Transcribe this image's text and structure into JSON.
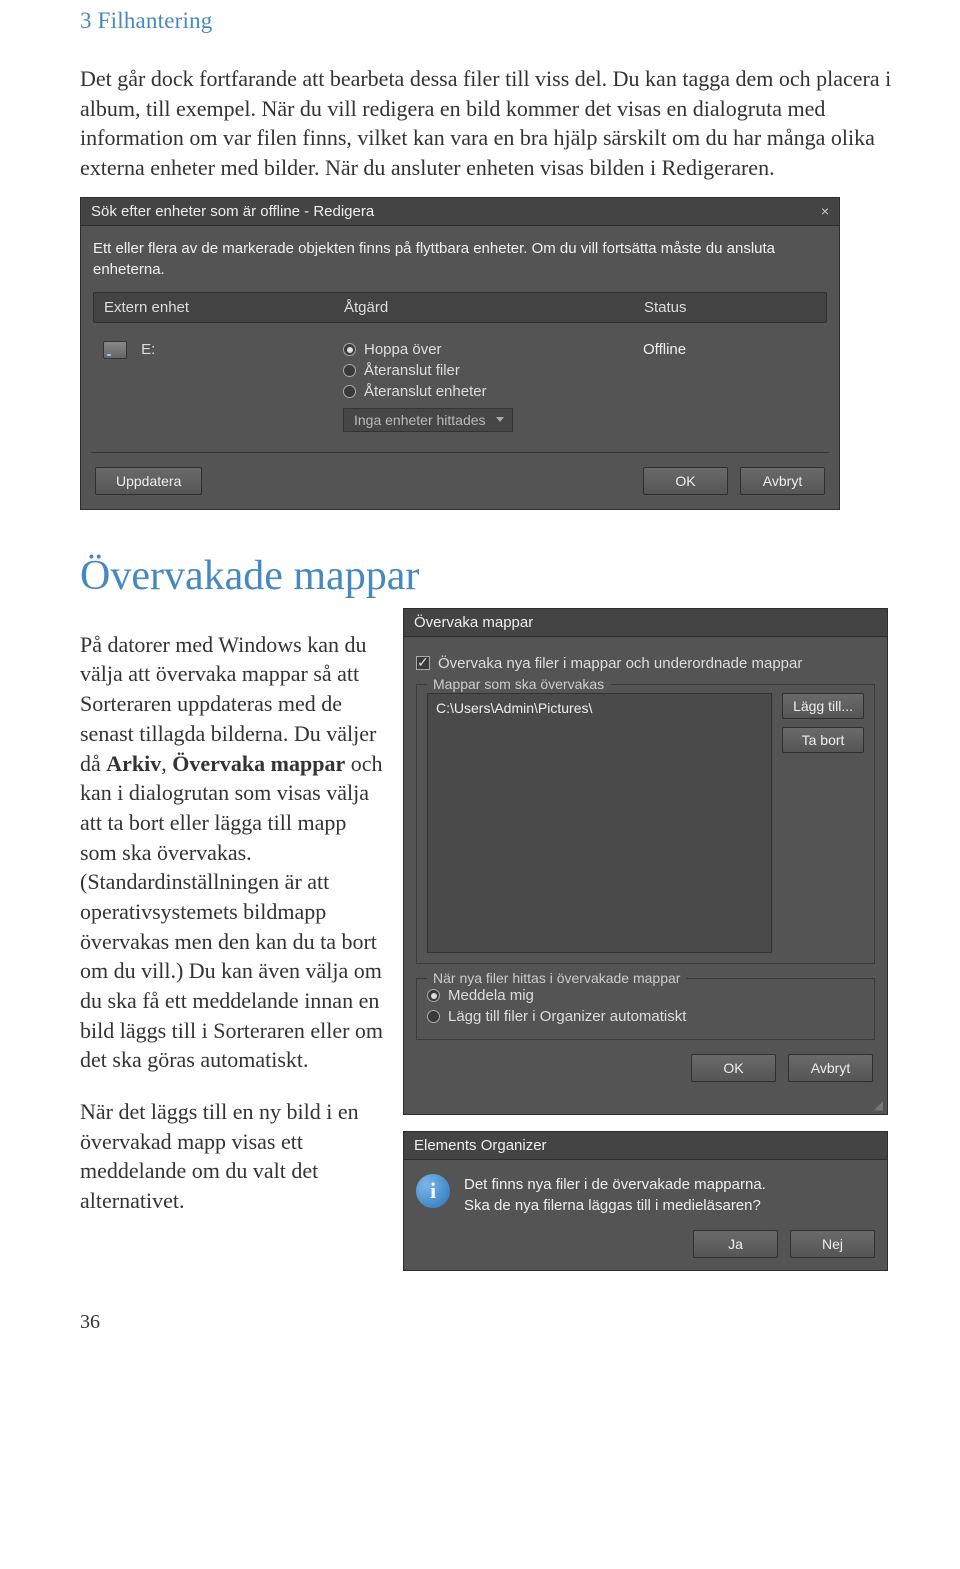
{
  "chapter": "3 Filhantering",
  "para1": "Det går dock fortfarande att bearbeta dessa filer till viss del. Du kan tagga dem och placera i album, till exempel. När du vill redigera en bild kommer det visas en dialogruta med information om var filen finns, vilket kan vara en bra hjälp särskilt om du har många olika externa enheter med bilder. När du ansluter enheten visas bilden i Redigeraren.",
  "dlg1": {
    "title": "Sök efter enheter som är offline - Redigera",
    "msg": "Ett eller flera av de markerade objekten finns på flyttbara enheter. Om du vill fortsätta måste du ansluta enheterna.",
    "head": {
      "c1": "Extern enhet",
      "c2": "Åtgärd",
      "c3": "Status"
    },
    "drive": "E:",
    "opt1": "Hoppa över",
    "opt2": "Återanslut filer",
    "opt3": "Återanslut enheter",
    "combo": "Inga enheter hittades",
    "status": "Offline",
    "btn_update": "Uppdatera",
    "btn_ok": "OK",
    "btn_cancel": "Avbryt"
  },
  "section_title": "Övervakade mappar",
  "para2a": "På datorer med Windows kan du välja att övervaka mappar så att Sorteraren uppdateras med de senast tillagda bilderna. Du väljer då ",
  "para2b": "Arkiv",
  "para2c": ", ",
  "para2d": "Övervaka mappar",
  "para2e": " och kan i dialog­rutan som visas välja att ta bort eller lägga till mapp som ska övervakas. (Standardinställningen är att operativsystemets bild­mapp övervakas men den kan du ta bort om du vill.) Du kan även välja om du ska få ett meddelande innan en bild läggs till i Sorteraren eller om det ska göras automatiskt.",
  "para3": "När det läggs till en ny bild i en övervakad mapp visas ett meddelande om du valt det alternativet.",
  "dlg2": {
    "title": "Övervaka mappar",
    "check": "Övervaka nya filer i mappar och underordnade mappar",
    "legend1": "Mappar som ska övervakas",
    "folder": "C:\\Users\\Admin\\Pictures\\",
    "btn_add": "Lägg till...",
    "btn_remove": "Ta bort",
    "legend2": "När nya filer hittas i övervakade mappar",
    "opt1": "Meddela mig",
    "opt2": "Lägg till filer i Organizer automatiskt",
    "btn_ok": "OK",
    "btn_cancel": "Avbryt"
  },
  "dlg3": {
    "title": "Elements Organizer",
    "line1": "Det finns nya filer i de övervakade mapparna.",
    "line2": "Ska de nya filerna läggas till i medieläsaren?",
    "btn_yes": "Ja",
    "btn_no": "Nej"
  },
  "page_num": "36"
}
